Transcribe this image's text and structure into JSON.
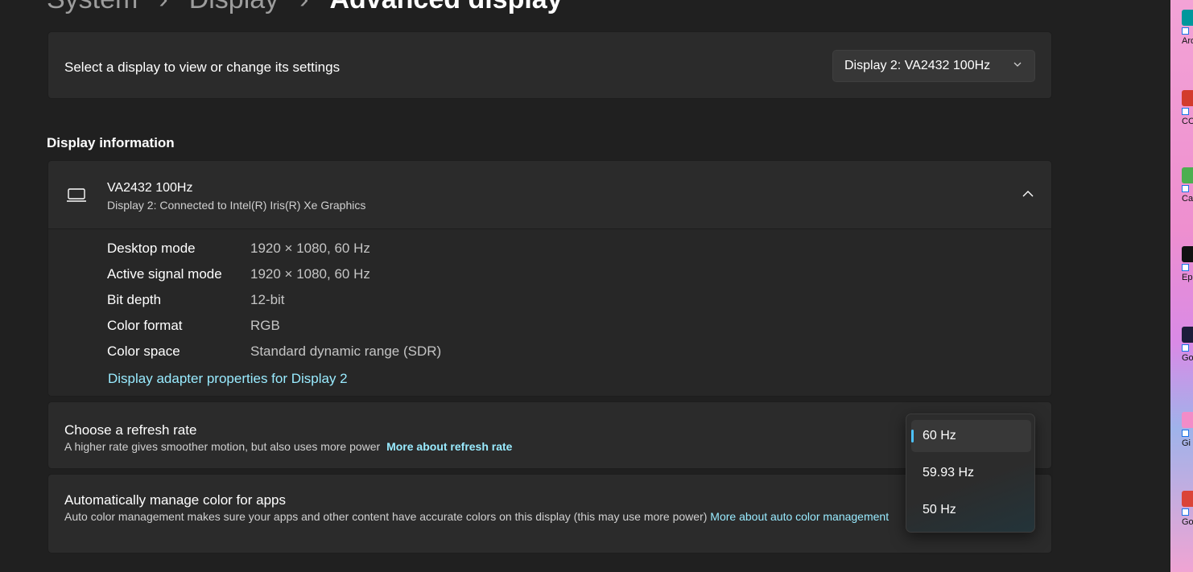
{
  "breadcrumb": {
    "items": [
      "System",
      "Display",
      "Advanced display"
    ],
    "separator": "›"
  },
  "display_select": {
    "label": "Select a display to view or change its settings",
    "selected": "Display 2: VA2432 100Hz"
  },
  "display_info": {
    "section_title": "Display information",
    "monitor_name": "VA2432 100Hz",
    "connection": "Display 2: Connected to Intel(R) Iris(R) Xe Graphics",
    "rows": [
      {
        "key": "Desktop mode",
        "value": "1920 × 1080, 60 Hz"
      },
      {
        "key": "Active signal mode",
        "value": "1920 × 1080, 60 Hz"
      },
      {
        "key": "Bit depth",
        "value": "12-bit"
      },
      {
        "key": "Color format",
        "value": "RGB"
      },
      {
        "key": "Color space",
        "value": "Standard dynamic range (SDR)"
      }
    ],
    "adapter_link": "Display adapter properties for Display 2"
  },
  "refresh_rate": {
    "title": "Choose a refresh rate",
    "description": "A higher rate gives smoother motion, but also uses more power",
    "link": "More about refresh rate",
    "options": [
      "60 Hz",
      "59.93 Hz",
      "50 Hz"
    ],
    "selected": "60 Hz"
  },
  "color_management": {
    "title": "Automatically manage color for apps",
    "description": "Auto color management makes sure your apps and other content have accurate colors on this display (this may use more power)",
    "link": "More about auto color management"
  },
  "desktop_icons": [
    {
      "label": "Ardu",
      "color": "#00979c"
    },
    {
      "label": "CC",
      "color": "#d33b2c"
    },
    {
      "label": "Ca",
      "color": "#4caf50"
    },
    {
      "label": "Epic Lau",
      "color": "#111111"
    },
    {
      "label": "Go Bo",
      "color": "#1c1c3a"
    },
    {
      "label": "Gi",
      "color": "#f28cc8"
    },
    {
      "label": "Go Ch",
      "color": "#db4437"
    }
  ],
  "colors": {
    "accent": "#4cc2ff",
    "link": "#99ebff",
    "background": "#202020",
    "card": "#2b2b2b"
  }
}
